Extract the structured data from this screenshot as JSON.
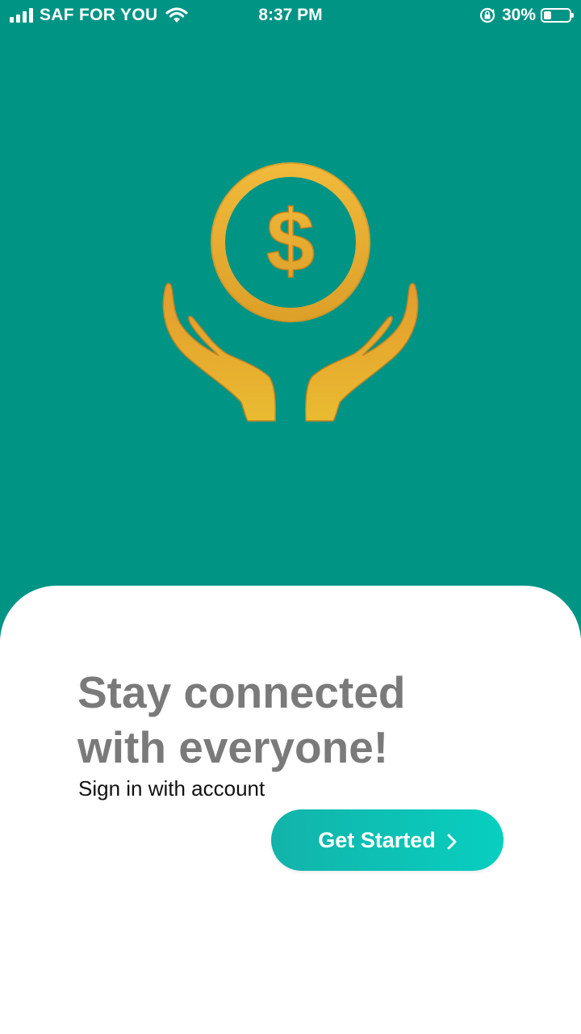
{
  "status_bar": {
    "carrier": "SAF FOR YOU",
    "time": "8:37 PM",
    "battery_percent_label": "30%",
    "battery_level": 0.3,
    "icons": [
      "signal-icon",
      "wifi-icon",
      "orientation-lock-icon",
      "battery-icon"
    ]
  },
  "hero": {
    "background_color": "#009485",
    "illustration": "hands-holding-dollar-coin-icon",
    "illustration_color": "#E2A72E"
  },
  "onboarding": {
    "headline_line1": "Stay connected",
    "headline_line2": "with everyone!",
    "subtitle": "Sign in with account",
    "cta_label": "Get Started",
    "cta_icon": "chevron-right-icon",
    "accent_color": "#07CFC0"
  }
}
